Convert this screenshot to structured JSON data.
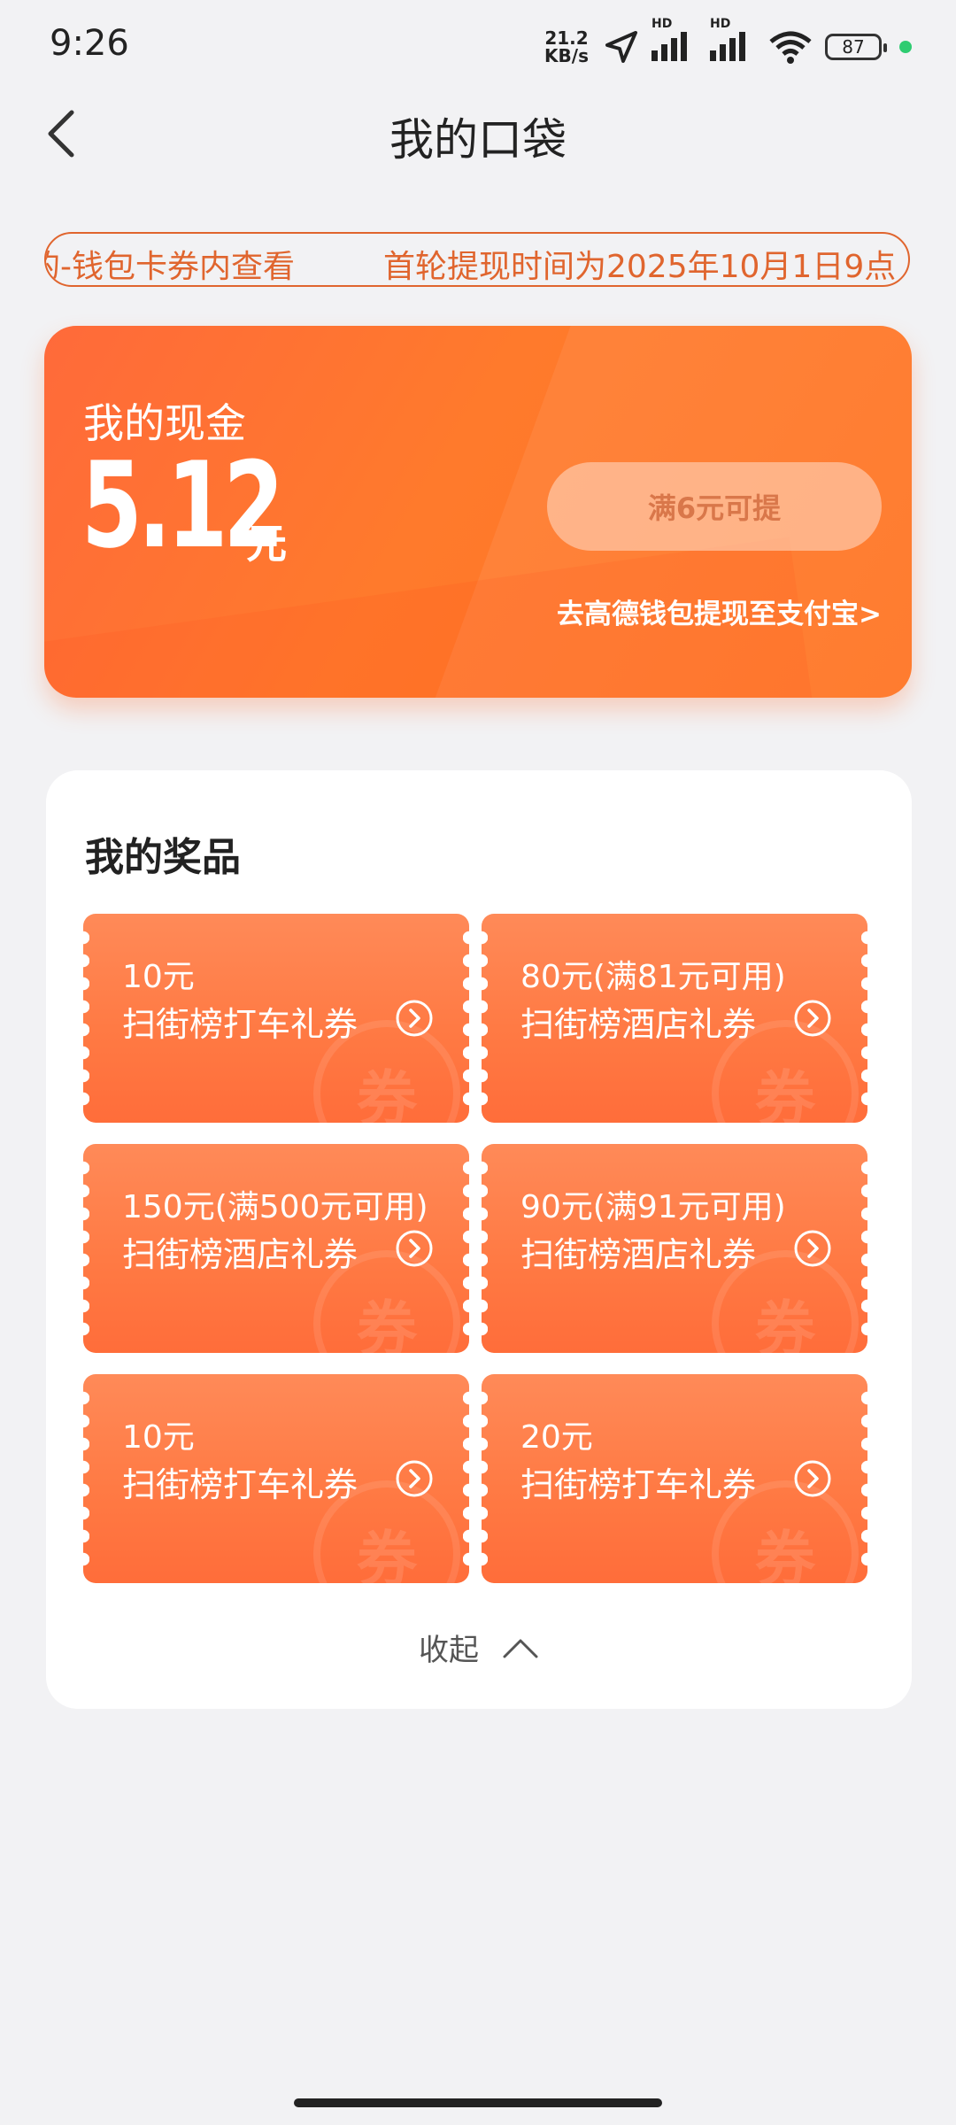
{
  "status_bar": {
    "time": "9:26",
    "net_speed_value": "21.2",
    "net_speed_unit": "KB/s",
    "battery": "87",
    "signal_label_1": "HD",
    "signal_label_2": "HD",
    "icons": [
      "location-icon",
      "signal-icon",
      "signal-icon",
      "wifi-icon",
      "battery-icon",
      "privacy-dot-icon"
    ]
  },
  "header": {
    "title": "我的口袋",
    "back_icon": "chevron-left-icon"
  },
  "ticker": {
    "text_1": "的-钱包卡券内查看",
    "text_2": "首轮提现时间为2025年10月1日9点"
  },
  "cash": {
    "label": "我的现金",
    "amount": "5.12",
    "unit": "元",
    "withdraw_button": "满6元可提",
    "alipay_link": "去高德钱包提现至支付宝>"
  },
  "prizes": {
    "title": "我的奖品",
    "watermark": "券",
    "items": [
      {
        "value": "10元",
        "name": "扫街榜打车礼券"
      },
      {
        "value": "80元(满81元可用)",
        "name": "扫街榜酒店礼券"
      },
      {
        "value": "150元(满500元可用)",
        "name": "扫街榜酒店礼券"
      },
      {
        "value": "90元(满91元可用)",
        "name": "扫街榜酒店礼券"
      },
      {
        "value": "10元",
        "name": "扫街榜打车礼券"
      },
      {
        "value": "20元",
        "name": "扫街榜打车礼券"
      }
    ],
    "collapse_label": "收起"
  },
  "colors": {
    "accent": "#ff7a2c",
    "ticker_text": "#e0652e",
    "background": "#f2f2f4"
  }
}
